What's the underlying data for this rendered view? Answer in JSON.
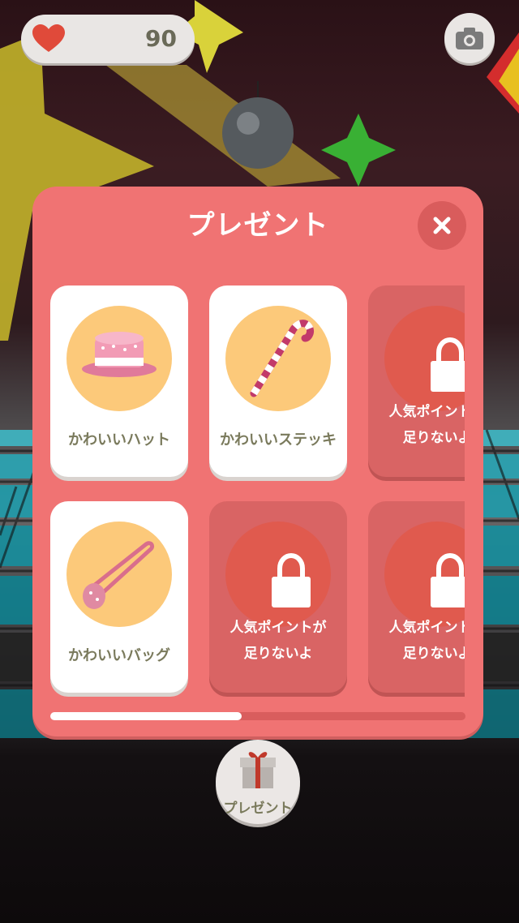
{
  "status": {
    "heart_count": "90"
  },
  "modal": {
    "title": "プレゼント",
    "items": [
      {
        "label": "かわいいハット",
        "locked": false,
        "icon": "cute-hat"
      },
      {
        "label": "かわいいステッキ",
        "locked": false,
        "icon": "cute-stick"
      },
      {
        "label": "人気ポイントが\n足りないよ",
        "locked": true,
        "icon": "lock"
      },
      {
        "label": "かわいいバッグ",
        "locked": false,
        "icon": "cute-bag"
      },
      {
        "label": "人気ポイントが\n足りないよ",
        "locked": true,
        "icon": "lock"
      },
      {
        "label": "人気ポイントが\n足りないよ",
        "locked": true,
        "icon": "lock"
      }
    ],
    "scroll_progress": 0.46
  },
  "bottom": {
    "present_label": "プレゼント"
  },
  "colors": {
    "modal": "#f07373",
    "accent_circle": "#fcc97a",
    "locked_card": "#d96464",
    "heart": "#e04a3a"
  }
}
